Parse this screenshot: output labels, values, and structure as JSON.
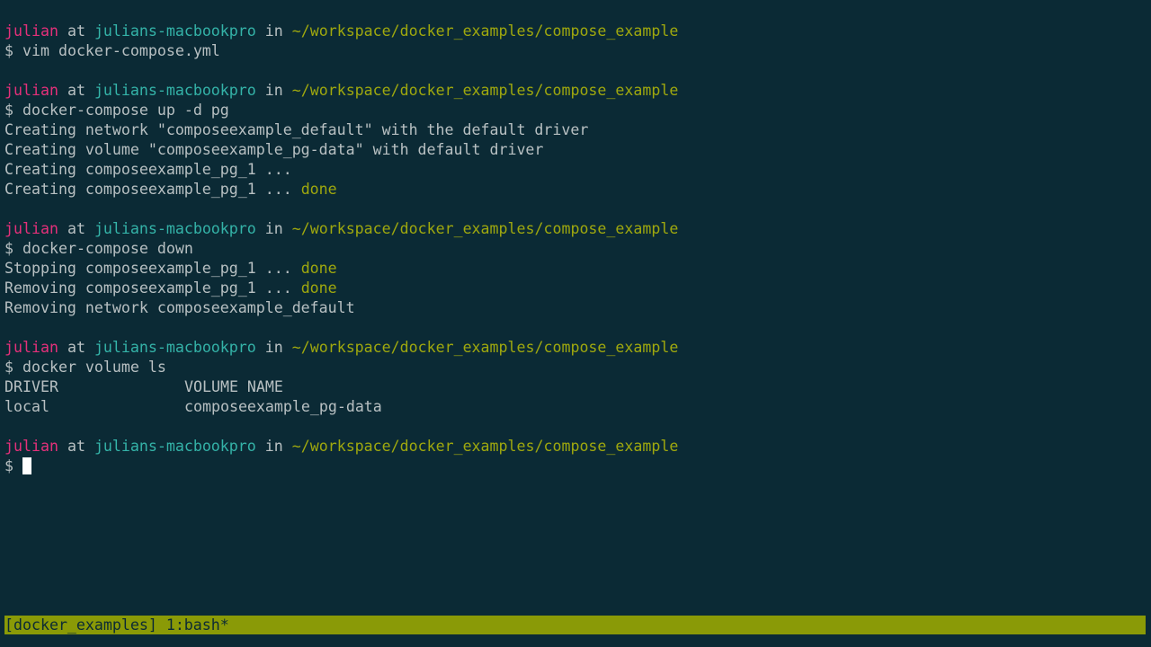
{
  "prompt": {
    "user": "julian",
    "at": "at",
    "host": "julians-macbookpro",
    "in": "in",
    "path": "~/workspace/docker_examples/compose_example",
    "symbol": "$"
  },
  "blocks": [
    {
      "command": "vim docker-compose.yml",
      "output": []
    },
    {
      "command": "docker-compose up -d pg",
      "output": [
        {
          "text": "Creating network \"composeexample_default\" with the default driver"
        },
        {
          "text": "Creating volume \"composeexample_pg-data\" with default driver"
        },
        {
          "text": "Creating composeexample_pg_1 ..."
        },
        {
          "text": "Creating composeexample_pg_1 ... ",
          "status": "done"
        }
      ]
    },
    {
      "command": "docker-compose down",
      "output": [
        {
          "text": "Stopping composeexample_pg_1 ... ",
          "status": "done"
        },
        {
          "text": "Removing composeexample_pg_1 ... ",
          "status": "done"
        },
        {
          "text": "Removing network composeexample_default"
        }
      ]
    },
    {
      "command": "docker volume ls",
      "table": {
        "headers": [
          "DRIVER",
          "VOLUME NAME"
        ],
        "rows": [
          [
            "local",
            "composeexample_pg-data"
          ]
        ]
      }
    }
  ],
  "statusbar": {
    "text": "[docker_examples] 1:bash*"
  },
  "colors": {
    "background": "#0b2a35",
    "user": "#e4307a",
    "host": "#34b3a8",
    "path": "#9fa80e",
    "text": "#b8c0c2",
    "statusbar": "#8a9a07"
  }
}
